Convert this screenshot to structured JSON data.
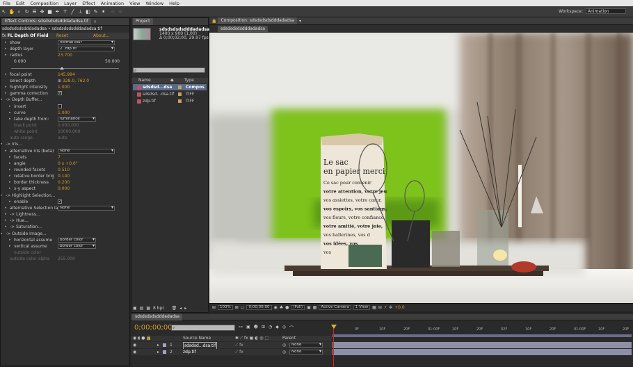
{
  "menu": [
    "File",
    "Edit",
    "Composition",
    "Layer",
    "Effect",
    "Animation",
    "View",
    "Window",
    "Help"
  ],
  "workspace": {
    "label": "Workspace:",
    "value": "Animation"
  },
  "effect_controls": {
    "tab": "Effect Controls: sdsdsdsdsdddadadsa.tif",
    "breadcrumb": "sdsdsdsdsdddadadsa • sdsdsdsdsdddadadsa.tif",
    "effect_name": "FL Depth Of Field",
    "reset": "Reset",
    "about": "About...",
    "rows": [
      {
        "label": "show",
        "value": "normal blur",
        "kind": "dd",
        "indent": 1
      },
      {
        "label": "depth layer",
        "value": "2. zdp.tif",
        "kind": "dd",
        "indent": 1
      },
      {
        "label": "radius",
        "value": "23.700",
        "kind": "num",
        "indent": 1
      },
      {
        "label": "0.000",
        "value": "50.000",
        "kind": "range",
        "indent": 2
      },
      {
        "label": "",
        "value": "",
        "kind": "slider",
        "indent": 2
      },
      {
        "label": "focal point",
        "value": "145.994",
        "kind": "num",
        "indent": 1
      },
      {
        "label": "select depth",
        "value": "328.0, 762.0",
        "kind": "point",
        "indent": 1
      },
      {
        "label": "highlight intensity",
        "value": "1.000",
        "kind": "num",
        "indent": 1
      },
      {
        "label": "gamma correction",
        "value": "✓",
        "kind": "cb",
        "indent": 1
      },
      {
        "label": "-> Depth Buffer...",
        "value": "",
        "kind": "group",
        "indent": 0
      },
      {
        "label": "invert",
        "value": "",
        "kind": "cb",
        "indent": 2
      },
      {
        "label": "curve",
        "value": "1.000",
        "kind": "num",
        "indent": 2
      },
      {
        "label": "take depth from:",
        "value": "luminance",
        "kind": "dd",
        "indent": 2
      },
      {
        "label": "black point",
        "value": "0.000,000",
        "kind": "dim",
        "indent": 2
      },
      {
        "label": "white point",
        "value": "10000.000",
        "kind": "dim",
        "indent": 2
      },
      {
        "label": "auto range",
        "value": "auto",
        "kind": "dim",
        "indent": 1
      },
      {
        "label": "-> Iris...",
        "value": "",
        "kind": "group",
        "indent": 0
      },
      {
        "label": "alternative iris (beta)",
        "value": "None",
        "kind": "dd",
        "indent": 1
      },
      {
        "label": "facets",
        "value": "7",
        "kind": "num",
        "indent": 2
      },
      {
        "label": "angle",
        "value": "0 x +0.0°",
        "kind": "num",
        "indent": 2
      },
      {
        "label": "rounded facets",
        "value": "0.510",
        "kind": "num",
        "indent": 2
      },
      {
        "label": "relative border brig",
        "value": "0.140",
        "kind": "num",
        "indent": 2
      },
      {
        "label": "border thickness",
        "value": "0.200",
        "kind": "num",
        "indent": 2
      },
      {
        "label": "x-y aspect",
        "value": "0.000",
        "kind": "num",
        "indent": 2
      },
      {
        "label": "-> Highlight Selection...",
        "value": "",
        "kind": "group",
        "indent": 0
      },
      {
        "label": "enable",
        "value": "✓",
        "kind": "cb",
        "indent": 2
      },
      {
        "label": "alternative Selection la",
        "value": "None",
        "kind": "dd",
        "indent": 1
      },
      {
        "label": "-> Lightness...",
        "value": "",
        "kind": "group",
        "indent": 1
      },
      {
        "label": "-> Hue...",
        "value": "",
        "kind": "group",
        "indent": 1
      },
      {
        "label": "-> Saturation...",
        "value": "",
        "kind": "group",
        "indent": 1
      },
      {
        "label": "-> Outside Image...",
        "value": "",
        "kind": "group",
        "indent": 0
      },
      {
        "label": "horizontal assume",
        "value": "border color",
        "kind": "dd",
        "indent": 2
      },
      {
        "label": "vertical assume",
        "value": "border color",
        "kind": "dd",
        "indent": 2
      },
      {
        "label": "outside color",
        "value": "",
        "kind": "dim",
        "indent": 2
      },
      {
        "label": "outside color alpha",
        "value": "255.000",
        "kind": "dim",
        "indent": 1
      }
    ]
  },
  "project": {
    "tab": "Project",
    "item_name": "sdsdsdsdsdddadadsa▾",
    "item_info1": "1400 x 900 (1.00)",
    "item_info2": "Δ 0;00;02;00, 29.97 fps",
    "search_placeholder": "",
    "col_name": "Name",
    "col_type": "Type",
    "items": [
      {
        "name": "sdsdsd...dsa",
        "type": "Compos",
        "selected": true
      },
      {
        "name": "sdsdsd...dsa.tif",
        "type": "TIFF",
        "selected": false
      },
      {
        "name": "zdp.tif",
        "type": "TIFF",
        "selected": false
      }
    ],
    "bpc": "8 bpc"
  },
  "composition": {
    "tab": "Composition: sdsdsdsdsdddadadsa",
    "subtab": "sdsdsdsdsdddadadsa",
    "zoom": "100%",
    "time": "0;00;00;00",
    "res": "(Full)",
    "camera": "Active Camera",
    "view": "1 View",
    "offset": "+0.0",
    "bag_text": [
      "Le sac",
      "en papier merci",
      "Ce sac pour contenir",
      "votre attention, votre jeu",
      "vos assiettes, votre cœur,",
      "vos espoirs, vos santiags,",
      "vos fleurs, votre confiance,",
      "votre amitié, votre joie,",
      "vos ballerines, vos d",
      "vos idées, vos",
      "vos"
    ]
  },
  "timeline": {
    "tab": "sdsdsdsdsdddadadsa",
    "timecode": "0;00;00;00",
    "col_source": "Source Name",
    "col_parent": "Parent",
    "ruler": [
      "0F",
      "10F",
      "20F",
      "01:00F",
      "10F",
      "20F",
      "02F",
      "10F",
      "20F",
      "01:00F",
      "10F",
      "20F"
    ],
    "layers": [
      {
        "num": "1",
        "name": "sdsdsd...dsa.tif",
        "parent": "None"
      },
      {
        "num": "2",
        "name": "zdp.tif",
        "parent": "None"
      }
    ]
  }
}
